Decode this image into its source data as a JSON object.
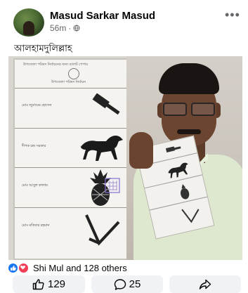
{
  "post": {
    "author": "Masud Sarkar Masud",
    "time": "56m",
    "separator": "·",
    "text": "আলহামদুলিল্লাহ"
  },
  "ballot": {
    "header_line1": "উপজেলা পরিষদ নির্বাচনের জন্য ব্যালট পেপার",
    "header_line2": "উপজেলা পরিষদ নির্বাচন",
    "candidates": [
      {
        "name": "মোঃ জুবায়ের হোসেন",
        "symbol": "hammer-icon"
      },
      {
        "name": "দীপক চন্দ্র সরকার",
        "symbol": "horse-icon"
      },
      {
        "name": "মোঃ আবুল কালাম",
        "symbol": "pineapple-icon"
      },
      {
        "name": "মোঃ মতিয়ার রহমান",
        "symbol": "plough-icon"
      }
    ]
  },
  "reactions": {
    "label": "Shi Mul and 128 others",
    "types": [
      "like-icon",
      "love-icon"
    ]
  },
  "actions": {
    "like_count": "129",
    "comment_count": "25"
  },
  "colors": {
    "like_blue": "#1877f2",
    "love_red": "#f33e58",
    "button_bg": "#f0f2f5",
    "meta_gray": "#65676b"
  }
}
